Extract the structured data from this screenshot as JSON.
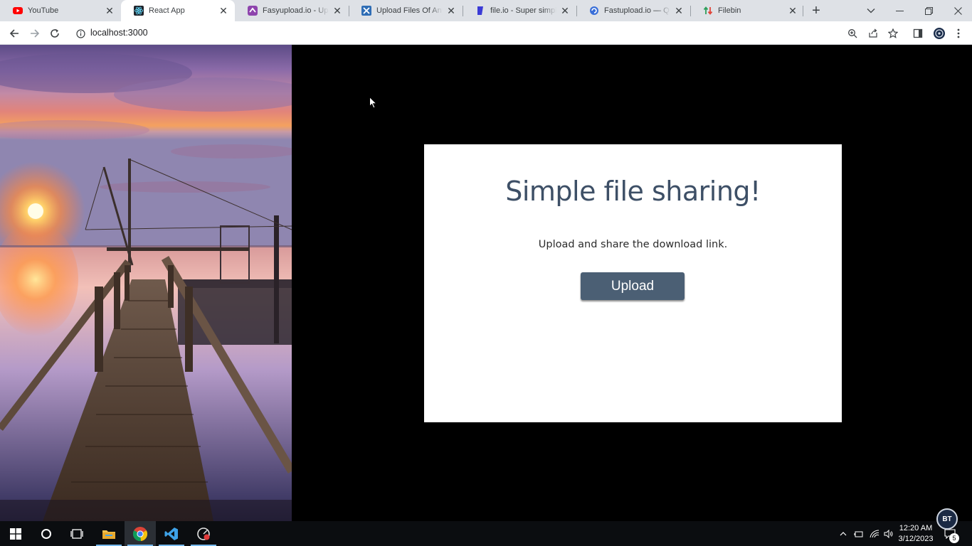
{
  "browser": {
    "tabs": [
      {
        "title": "YouTube",
        "icon": "youtube-icon"
      },
      {
        "title": "React App",
        "icon": "react-icon",
        "active": true
      },
      {
        "title": "Fasyupload.io - Upload",
        "icon": "fasyupload-icon"
      },
      {
        "title": "Upload Files Of Any Size",
        "icon": "upload-files-icon"
      },
      {
        "title": "file.io - Super simple file sharing",
        "icon": "fileio-icon"
      },
      {
        "title": "Fastupload.io — Quick",
        "icon": "fastupload-icon"
      },
      {
        "title": "Filebin",
        "icon": "filebin-icon"
      }
    ],
    "address": "localhost:3000"
  },
  "page": {
    "heading": "Simple file sharing!",
    "subtitle": "Upload and share the download link.",
    "upload_label": "Upload"
  },
  "taskbar": {
    "time": "12:20 AM",
    "date": "3/12/2023",
    "notification_count": "5",
    "profile_initials": "BT"
  },
  "colors": {
    "tab_strip": "#dee1e6",
    "button": "#4b5f74",
    "heading": "#3d4f66",
    "page_background": "#000000",
    "card": "#ffffff"
  }
}
